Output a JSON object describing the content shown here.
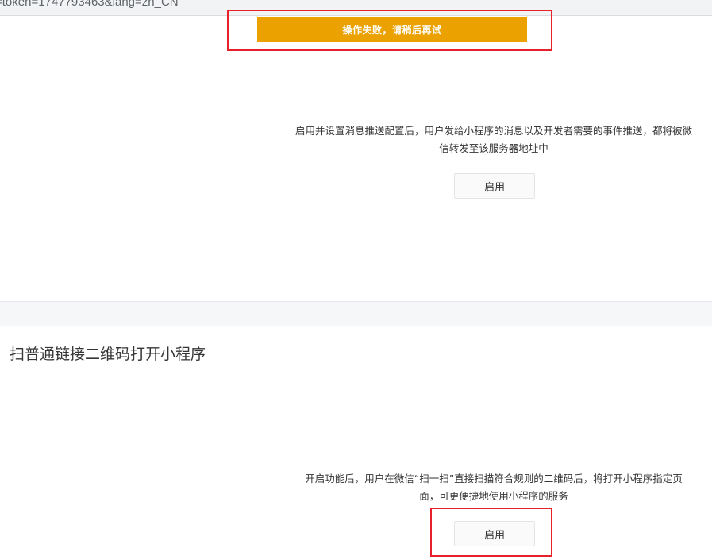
{
  "browser": {
    "url_fragment": "=token=1747793463&lang=zh_CN"
  },
  "toast": {
    "message": "操作失败，请稍后再试",
    "color": "#eba200"
  },
  "message_push": {
    "description": "启用并设置消息推送配置后，用户发给小程序的消息以及开发者需要的事件推送，都将被微信转发至该服务器地址中",
    "enable_label": "启用"
  },
  "qr_link": {
    "title": "扫普通链接二维码打开小程序",
    "description": "开启功能后，用户在微信“扫一扫”直接扫描符合规则的二维码后，将打开小程序指定页面，可更便捷地使用小程序的服务",
    "enable_label": "启用"
  },
  "annotation": {
    "highlight_color": "#e8202a"
  }
}
